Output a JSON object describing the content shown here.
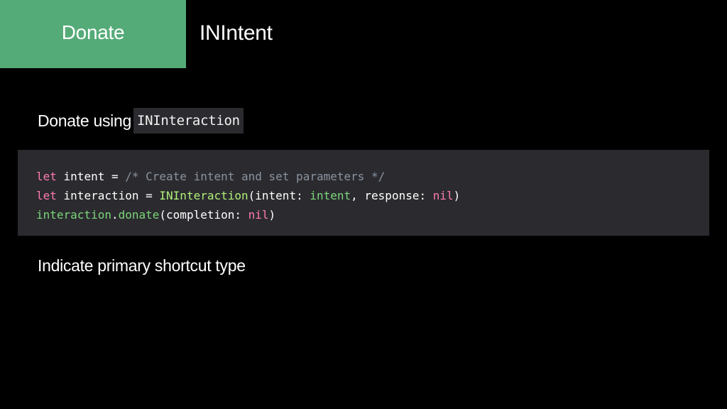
{
  "header": {
    "section_tab": "Donate",
    "title": "INIntent"
  },
  "body": {
    "subheading_1_text": "Donate using",
    "subheading_1_code": "INInteraction",
    "subheading_2": "Indicate primary shortcut type"
  },
  "code": {
    "line1": {
      "kw": "let",
      "rest": " intent = ",
      "comment": "/* Create intent and set parameters */"
    },
    "line2": {
      "kw": "let",
      "rest": " interaction = ",
      "type": "INInteraction",
      "open": "(intent: ",
      "arg": "intent",
      "mid": ", response: ",
      "nil": "nil",
      "close": ")"
    },
    "line3": {
      "obj": "interaction",
      "dot": ".",
      "method": "donate",
      "open": "(completion: ",
      "nil": "nil",
      "close": ")"
    }
  },
  "colors": {
    "tab_background": "#55ab78",
    "code_background": "#2b2b2f",
    "keyword": "#ff7ab2",
    "comment": "#8a93a0",
    "type": "#b0f07a",
    "identifier": "#7bd67a"
  }
}
